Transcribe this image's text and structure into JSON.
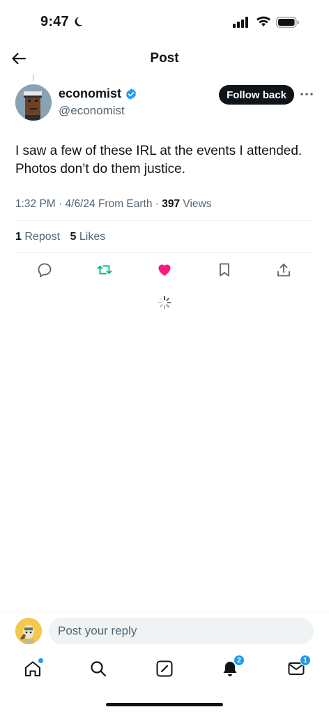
{
  "status_bar": {
    "time": "9:47"
  },
  "header": {
    "title": "Post"
  },
  "post": {
    "author": {
      "name": "economist",
      "handle": "@economist"
    },
    "follow_label": "Follow back",
    "text": "I saw a few of these IRL at the events I attended. Photos don’t do them justice.",
    "meta": {
      "time": "1:32 PM",
      "date": "4/6/24",
      "source": "From Earth",
      "views_count": "397",
      "views_label": "Views"
    },
    "stats": {
      "reposts_count": "1",
      "reposts_label": "Repost",
      "likes_count": "5",
      "likes_label": "Likes"
    },
    "liked": true,
    "reposted": true
  },
  "reply": {
    "placeholder": "Post your reply"
  },
  "tabs": {
    "home": {
      "icon": "home-icon",
      "has_dot": true
    },
    "search": {
      "icon": "search-icon"
    },
    "compose": {
      "icon": "compose-icon"
    },
    "notifications": {
      "icon": "bell-icon",
      "badge": "2"
    },
    "messages": {
      "icon": "mail-icon",
      "badge": "1"
    }
  },
  "colors": {
    "accent": "#1d9bf0",
    "like": "#f91880",
    "repost": "#00ba7c",
    "text": "#0f1419",
    "secondary": "#536471"
  }
}
